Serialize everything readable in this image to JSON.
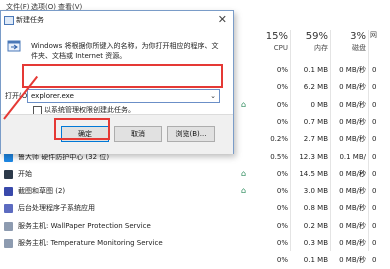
{
  "menubar": {
    "items": [
      {
        "label": "文件(F)",
        "x": 6
      },
      {
        "label": "选项(O)",
        "x": 31
      },
      {
        "label": "查看(V)",
        "x": 58
      }
    ]
  },
  "columns": {
    "cpu": {
      "percent": "15%",
      "label": "CPU"
    },
    "memory": {
      "percent": "59%",
      "label": "内存"
    },
    "disk": {
      "percent": "3%",
      "label": "磁盘"
    },
    "network": {
      "percent": "",
      "label": "网"
    }
  },
  "processes": [
    {
      "name": "",
      "cpu": "0%",
      "mem": "0.1 MB",
      "disk": "0 MB/秒",
      "net": "0",
      "leaf": false,
      "icon": ""
    },
    {
      "name": "",
      "cpu": "0%",
      "mem": "6.2 MB",
      "disk": "0 MB/秒",
      "net": "0",
      "leaf": false,
      "icon": ""
    },
    {
      "name": "",
      "cpu": "0%",
      "mem": "0 MB",
      "disk": "0 MB/秒",
      "net": "0",
      "leaf": true,
      "icon": ""
    },
    {
      "name": "",
      "cpu": "0%",
      "mem": "0.7 MB",
      "disk": "0 MB/秒",
      "net": "0",
      "leaf": false,
      "icon": ""
    },
    {
      "name": "",
      "cpu": "0.2%",
      "mem": "2.7 MB",
      "disk": "0 MB/秒",
      "net": "0",
      "leaf": false,
      "icon": ""
    },
    {
      "name": "鲁大师 硬件防护中心 (32 位)",
      "cpu": "0.5%",
      "mem": "12.3 MB",
      "disk": "0.1 MB/秒",
      "net": "0",
      "leaf": false,
      "icon": "#1e88e5"
    },
    {
      "name": "开始",
      "cpu": "0%",
      "mem": "14.5 MB",
      "disk": "0 MB/秒",
      "net": "0",
      "leaf": true,
      "icon": "#2d3a4a"
    },
    {
      "name": "截图和草图 (2)",
      "cpu": "0%",
      "mem": "3.0 MB",
      "disk": "0 MB/秒",
      "net": "0",
      "leaf": true,
      "icon": "#3949ab"
    },
    {
      "name": "后台处理程序子系统应用",
      "cpu": "0%",
      "mem": "0.8 MB",
      "disk": "0 MB/秒",
      "net": "0",
      "leaf": false,
      "icon": "#5c6bc0"
    },
    {
      "name": "服务主机: WallPaper Protection Service",
      "cpu": "0%",
      "mem": "0.2 MB",
      "disk": "0 MB/秒",
      "net": "0",
      "leaf": false,
      "icon": "#8d9bb0"
    },
    {
      "name": "服务主机: Temperature Monitoring Service",
      "cpu": "0%",
      "mem": "0.3 MB",
      "disk": "0 MB/秒",
      "net": "0",
      "leaf": false,
      "icon": "#8d9bb0"
    },
    {
      "name": "",
      "cpu": "0%",
      "mem": "0.1 MB",
      "disk": "0 MB/秒",
      "net": "0",
      "leaf": false,
      "icon": "#8d9bb0"
    }
  ],
  "dialog": {
    "title": "新建任务",
    "close": "✕",
    "description": "Windows 将根据你所键入的名称，为你打开相应的程序、文件夹、文档或 Internet 资源。",
    "open_label": "打开(O):",
    "open_value": "explorer.exe",
    "admin_label": "以系统管理权限创建此任务。",
    "ok": "确定",
    "cancel": "取消",
    "browse": "浏览(B)..."
  },
  "accent": {
    "red": "#e53935",
    "blue": "#0078d7",
    "green": "#2a8a5a"
  }
}
